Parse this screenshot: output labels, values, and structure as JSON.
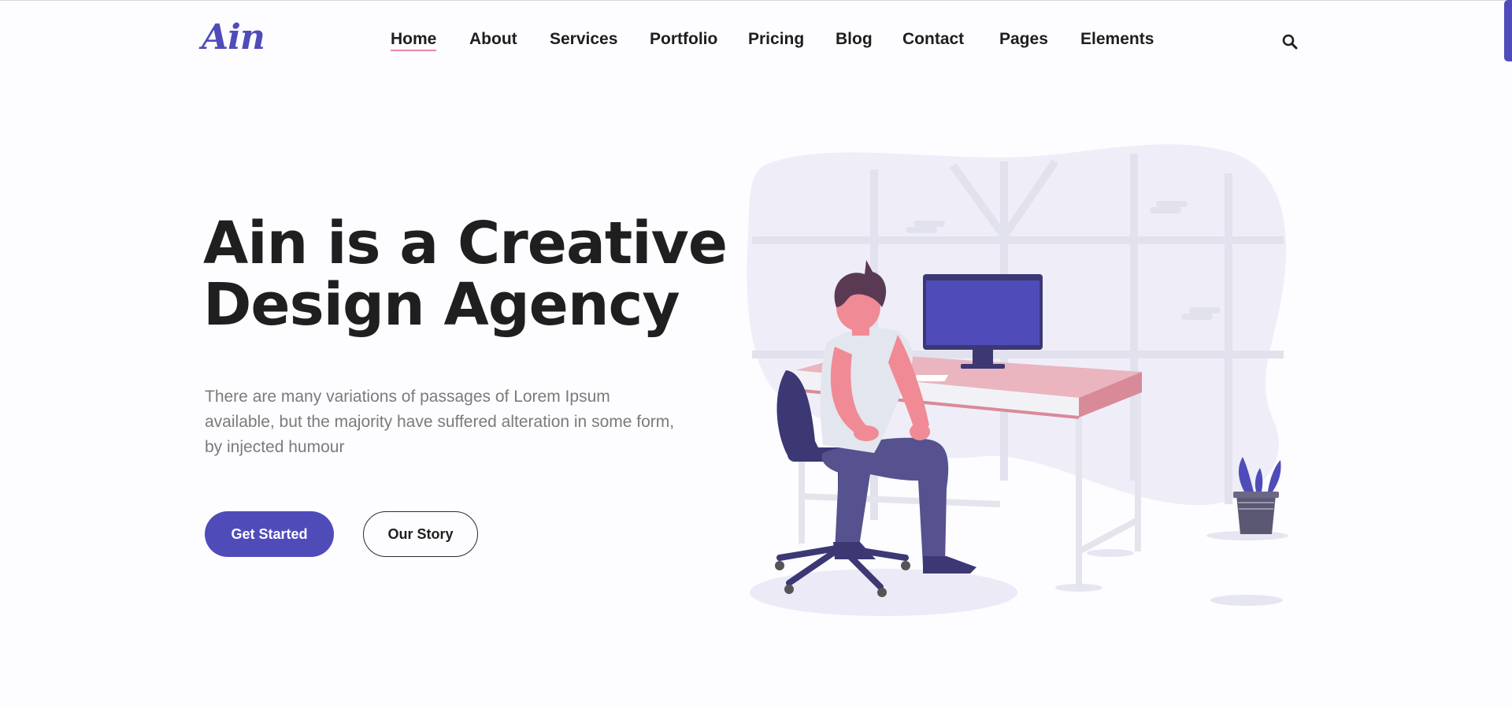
{
  "brand": {
    "logo_text": "Ain"
  },
  "nav": {
    "items": [
      "Home",
      "About",
      "Services",
      "Portfolio",
      "Pricing",
      "Blog",
      "Contact",
      "Pages",
      "Elements"
    ],
    "active": "Home"
  },
  "icons": {
    "search": "search-icon"
  },
  "hero": {
    "title_line1": "Ain is a Creative",
    "title_line2": "Design Agency",
    "description": "There are many variations of passages of Lorem Ipsum available, but the majority have suffered alteration in some form, by injected humour",
    "primary_button": "Get Started",
    "secondary_button": "Our Story"
  },
  "colors": {
    "accent": "#4f4cba",
    "nav_underline": "#e985b0",
    "heading": "#1f1f1f",
    "body_text": "#7b7b7b",
    "background": "#fdfcfe"
  },
  "illustration": "person sitting at desk with monitor and potted plant"
}
